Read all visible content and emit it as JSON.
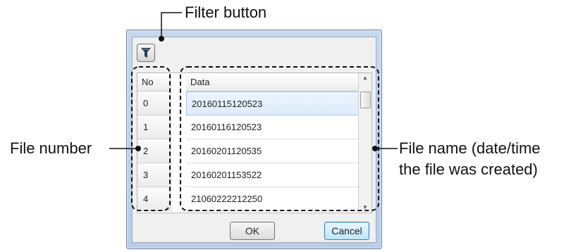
{
  "callouts": {
    "filter_button": "Filter button",
    "file_number": "File number",
    "file_name_line1": "File name (date/time",
    "file_name_line2": "the file was created)"
  },
  "dialog": {
    "filter_icon": "filter-funnel-icon",
    "columns": {
      "no": "No",
      "data": "Data"
    },
    "rows": [
      {
        "no": "0",
        "data": "20160115120523"
      },
      {
        "no": "1",
        "data": "20160116120523"
      },
      {
        "no": "2",
        "data": "20160201120535"
      },
      {
        "no": "3",
        "data": "20160201153522"
      },
      {
        "no": "4",
        "data": "21060222212250"
      }
    ],
    "selected_row": 0,
    "ok_label": "OK",
    "cancel_label": "Cancel"
  },
  "colors": {
    "window_frame": "#b9cde6",
    "selection": "#dcebfb",
    "default_button": "#bee6fd"
  }
}
